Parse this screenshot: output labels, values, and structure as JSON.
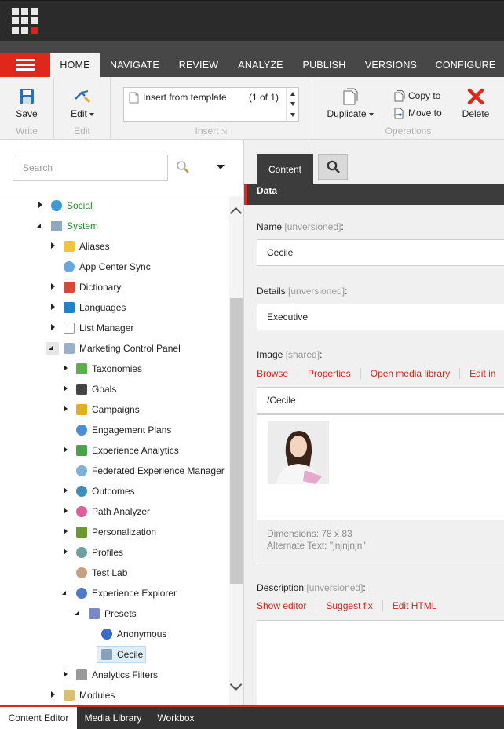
{
  "ribbon_tabs": [
    "HOME",
    "NAVIGATE",
    "REVIEW",
    "ANALYZE",
    "PUBLISH",
    "VERSIONS",
    "CONFIGURE"
  ],
  "ribbon": {
    "save_label": "Save",
    "write_label": "Write",
    "edit_btn_label": "Edit",
    "edit_group_label": "Edit",
    "insert_item": "Insert from template",
    "insert_count": "(1 of 1)",
    "insert_group_label": "Insert",
    "duplicate_label": "Duplicate",
    "copy_to_label": "Copy to",
    "move_to_label": "Move to",
    "delete_label": "Delete",
    "operations_label": "Operations"
  },
  "search": {
    "placeholder": "Search"
  },
  "tree": [
    "Social",
    "System",
    "Aliases",
    "App Center Sync",
    "Dictionary",
    "Languages",
    "List Manager",
    "Marketing Control Panel",
    "Taxonomies",
    "Goals",
    "Campaigns",
    "Engagement Plans",
    "Experience Analytics",
    "Federated Experience Manager",
    "Outcomes",
    "Path Analyzer",
    "Personalization",
    "Profiles",
    "Test Lab",
    "Experience Explorer",
    "Presets",
    "Anonymous",
    "Cecile",
    "Analytics Filters",
    "Modules"
  ],
  "editor": {
    "content_tab": "Content",
    "section_title": "Data",
    "name_label": "Name",
    "name_tag": "[unversioned]",
    "name_value": "Cecile",
    "details_label": "Details",
    "details_tag": "[unversioned]",
    "details_value": "Executive",
    "image_label": "Image",
    "image_tag": "[shared]",
    "image_links": [
      "Browse",
      "Properties",
      "Open media library",
      "Edit in"
    ],
    "image_path": "/Cecile",
    "image_dimensions": "Dimensions: 78 x 83",
    "image_alt": "Alternate Text: \"jnjnjnjn\"",
    "description_label": "Description",
    "description_tag": "[unversioned]",
    "description_links": [
      "Show editor",
      "Suggest fix",
      "Edit HTML"
    ]
  },
  "bottom_tabs": [
    "Content Editor",
    "Media Library",
    "Workbox"
  ],
  "colors": {
    "accent": "#e1261c",
    "dark": "#2b2b2b",
    "tree_green": "#2a8a2a"
  }
}
